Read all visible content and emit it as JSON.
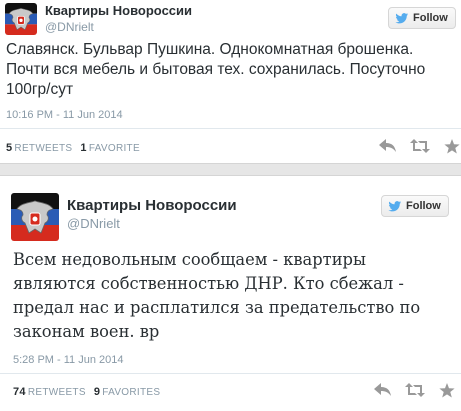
{
  "tweets": [
    {
      "name": "Квартиры Новороссии",
      "handle": "@DNrielt",
      "follow_label": "Follow",
      "text": "Славянск. Бульвар Пушкина. Однокомнатная брошенка. Почти вся мебель и бытовая тех. сохранилась. Посуточно 100гр/сут",
      "timestamp": "10:16 PM - 11 Jun 2014",
      "retweets_count": "5",
      "retweets_label": "RETWEETS",
      "favorites_count": "1",
      "favorites_label": "FAVORITE"
    },
    {
      "name": "Квартиры Новороссии",
      "handle": "@DNrielt",
      "follow_label": "Follow",
      "text": "Всем недовольным сообщаем - квартиры являются собственностью ДНР. Кто сбежал - предал нас и расплатился за предательство по законам воен. вр",
      "timestamp": "5:28 PM - 11 Jun 2014",
      "retweets_count": "74",
      "retweets_label": "RETWEETS",
      "favorites_count": "9",
      "favorites_label": "FAVORITES"
    }
  ],
  "icons": {
    "follow": "twitter-bird-icon",
    "reply": "reply-arrow-icon",
    "retweet": "retweet-icon",
    "favorite": "star-icon",
    "avatar": "dnr-coat-of-arms-avatar"
  },
  "colors": {
    "twitter_blue": "#55acee",
    "flag_black": "#111111",
    "flag_blue": "#2a5bb5",
    "flag_red": "#d52b1e",
    "muted_text": "#8899a6",
    "gap_gray": "#e6e6e6"
  }
}
